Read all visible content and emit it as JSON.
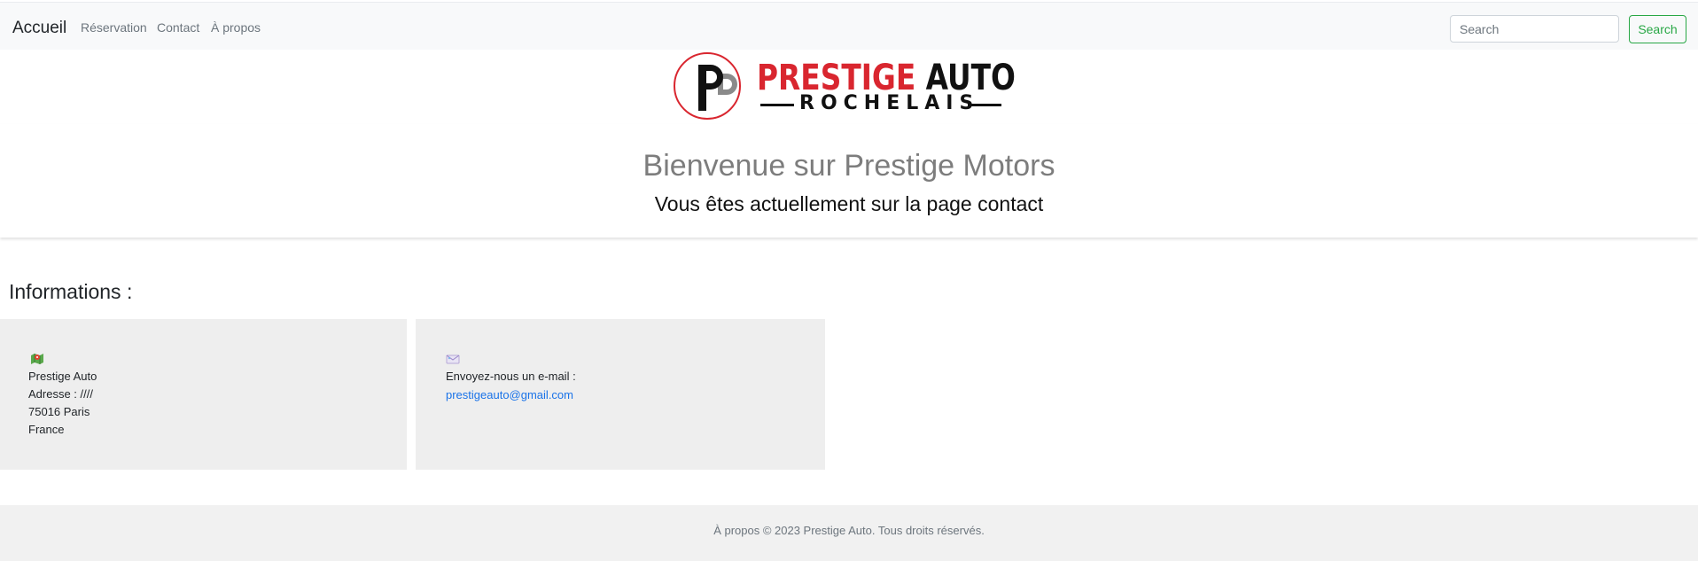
{
  "nav": {
    "brand": "Accueil",
    "links": [
      "Réservation",
      "Contact",
      "À propos"
    ],
    "search_placeholder": "Search",
    "search_button": "Search"
  },
  "logo": {
    "word_red": "PRESTIGE",
    "word_black": "AUTO",
    "sub": "ROCHELAIS",
    "colors": {
      "red": "#d9262f",
      "black": "#111111"
    }
  },
  "hero": {
    "title": "Bienvenue sur Prestige Motors",
    "subtitle": "Vous êtes actuellement sur la page contact"
  },
  "info": {
    "heading": "Informations :",
    "address_card": {
      "icon": "map-icon",
      "lines": [
        "Prestige Auto",
        "Adresse : ////",
        "75016 Paris",
        "France"
      ]
    },
    "email_card": {
      "icon": "email-icon",
      "label": "Envoyez-nous un e-mail :",
      "email": "prestigeauto@gmail.com"
    }
  },
  "footer": {
    "text": "À propos © 2023 Prestige Auto. Tous droits réservés."
  }
}
